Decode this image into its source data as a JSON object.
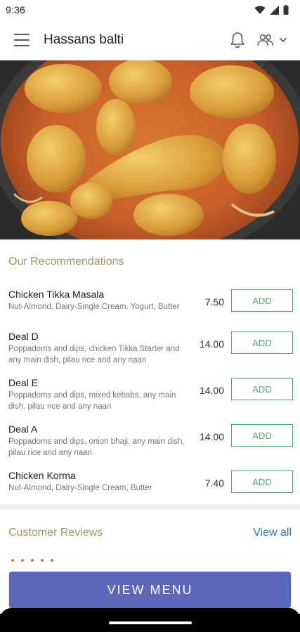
{
  "status_bar": {
    "time": "9:36"
  },
  "app_bar": {
    "title": "Hassans balti"
  },
  "recommendations": {
    "title": "Our Recommendations",
    "add_label": "ADD",
    "items": [
      {
        "name": "Chicken Tikka Masala",
        "desc": "Nut-Almond, Dairy-Single Cream, Yogurt, Butter",
        "price": "7.50"
      },
      {
        "name": "Deal D",
        "desc": "Poppadoms and dips, chicken Tikka Starter and any main dish, pilau rice and any naan",
        "price": "14.00"
      },
      {
        "name": "Deal E",
        "desc": "Poppadoms and dips, mixed kebabs, any main dish, pilau rice and any naan",
        "price": "14.00"
      },
      {
        "name": "Deal A",
        "desc": "Poppadoms and dips, onion bhaji, any main dish, pilau rice and any naan",
        "price": "14.00"
      },
      {
        "name": "Chicken Korma",
        "desc": "Nut-Almond, Dairy-Single Cream, Butter",
        "price": "7.40"
      }
    ]
  },
  "reviews": {
    "title": "Customer Reviews",
    "view_all": "View all"
  },
  "view_menu": {
    "label": "VIEW MENU"
  },
  "colors": {
    "accent_gold": "#9e9368",
    "add_green": "#4caf6e",
    "link_blue": "#2a7fb8",
    "button_indigo": "#5b67b8",
    "star_red": "#e46a4d"
  }
}
